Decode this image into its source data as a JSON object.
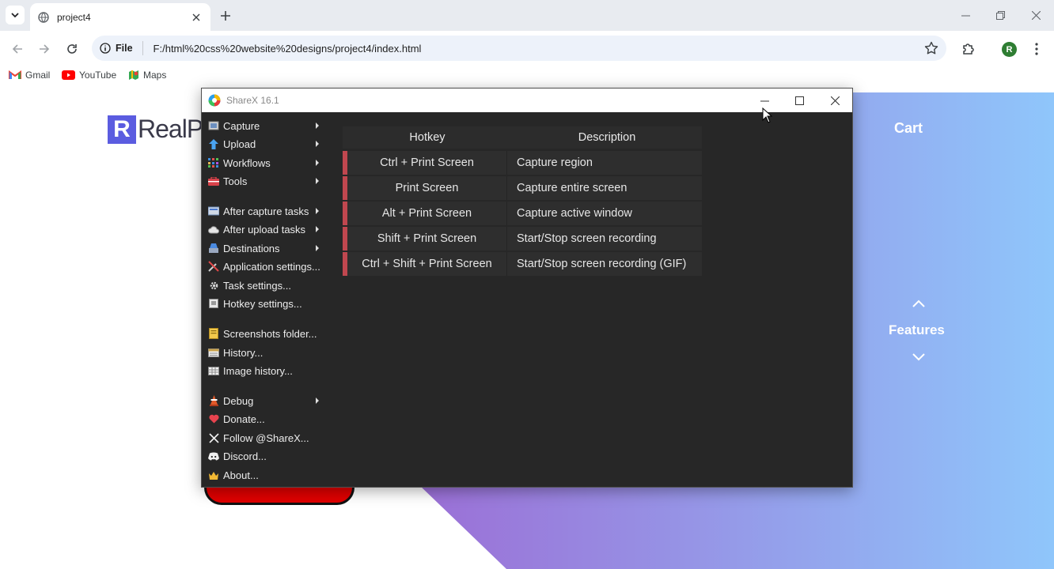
{
  "browser": {
    "tab_title": "project4",
    "url_scheme_label": "File",
    "url": "F:/html%20css%20website%20designs/project4/index.html",
    "avatar_letter": "R",
    "bookmarks": [
      {
        "label": "Gmail",
        "icon": "gmail-icon"
      },
      {
        "label": "YouTube",
        "icon": "youtube-icon"
      },
      {
        "label": "Maps",
        "icon": "maps-icon"
      }
    ]
  },
  "webpage": {
    "logo_mark": "R",
    "logo_text": "RealPh",
    "cart": "Cart",
    "features": "Features",
    "colors": {
      "gradient_start": "#9b6fd6",
      "gradient_end": "#8fc6fb"
    }
  },
  "sharex": {
    "title": "ShareX 16.1",
    "menu": [
      {
        "label": "Capture",
        "icon": "capture-icon",
        "submenu": true
      },
      {
        "label": "Upload",
        "icon": "upload-icon",
        "submenu": true
      },
      {
        "label": "Workflows",
        "icon": "workflows-icon",
        "submenu": true
      },
      {
        "label": "Tools",
        "icon": "tools-icon",
        "submenu": true
      },
      {
        "label": "After capture tasks",
        "icon": "after-capture-icon",
        "submenu": true
      },
      {
        "label": "After upload tasks",
        "icon": "after-upload-icon",
        "submenu": true
      },
      {
        "label": "Destinations",
        "icon": "destinations-icon",
        "submenu": true
      },
      {
        "label": "Application settings...",
        "icon": "application-settings-icon",
        "submenu": false
      },
      {
        "label": "Task settings...",
        "icon": "task-settings-icon",
        "submenu": false
      },
      {
        "label": "Hotkey settings...",
        "icon": "hotkey-settings-icon",
        "submenu": false
      },
      {
        "label": "Screenshots folder...",
        "icon": "screenshots-folder-icon",
        "submenu": false
      },
      {
        "label": "History...",
        "icon": "history-icon",
        "submenu": false
      },
      {
        "label": "Image history...",
        "icon": "image-history-icon",
        "submenu": false
      },
      {
        "label": "Debug",
        "icon": "debug-icon",
        "submenu": true
      },
      {
        "label": "Donate...",
        "icon": "heart-icon",
        "submenu": false
      },
      {
        "label": "Follow @ShareX...",
        "icon": "x-icon",
        "submenu": false
      },
      {
        "label": "Discord...",
        "icon": "discord-icon",
        "submenu": false
      },
      {
        "label": "About...",
        "icon": "crown-icon",
        "submenu": false
      }
    ],
    "hotkeys": {
      "headers": [
        "Hotkey",
        "Description"
      ],
      "rows": [
        {
          "key": "Ctrl + Print Screen",
          "desc": "Capture region"
        },
        {
          "key": "Print Screen",
          "desc": "Capture entire screen"
        },
        {
          "key": "Alt + Print Screen",
          "desc": "Capture active window"
        },
        {
          "key": "Shift + Print Screen",
          "desc": "Start/Stop screen recording"
        },
        {
          "key": "Ctrl + Shift + Print Screen",
          "desc": "Start/Stop screen recording (GIF)"
        }
      ]
    },
    "colors": {
      "background": "#272727",
      "accent_bar": "#c0474f"
    }
  }
}
